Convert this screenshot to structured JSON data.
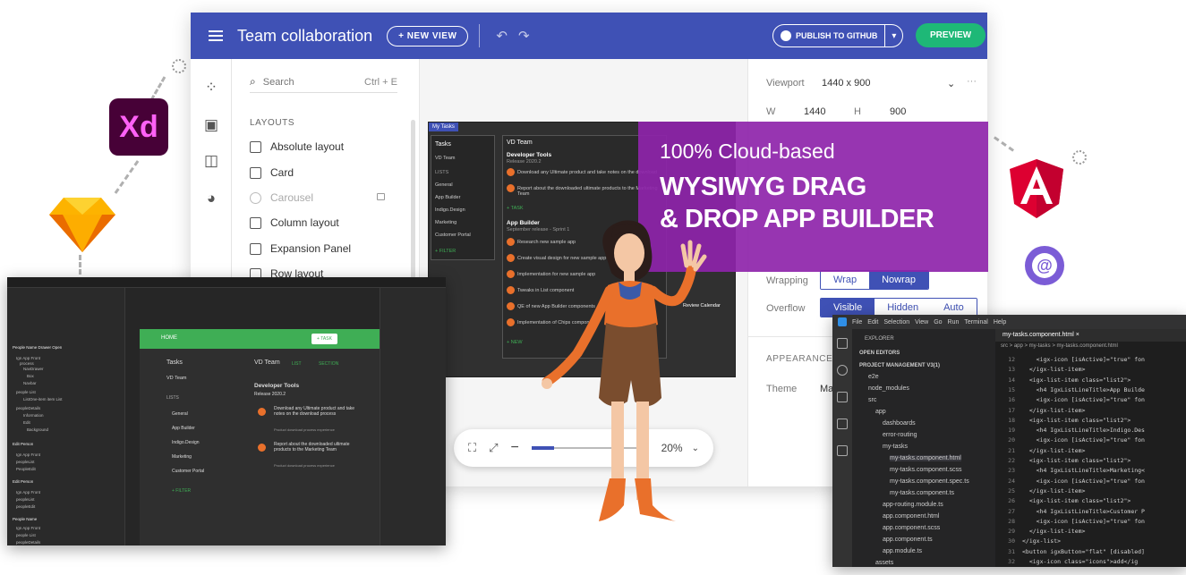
{
  "topbar": {
    "title": "Team collaboration",
    "new_view": "+ NEW VIEW",
    "publish": "PUBLISH TO GITHUB",
    "preview": "PREVIEW"
  },
  "components": {
    "search_placeholder": "Search",
    "search_shortcut": "Ctrl + E",
    "section": "LAYOUTS",
    "items": [
      {
        "label": "Absolute layout"
      },
      {
        "label": "Card"
      },
      {
        "label": "Carousel",
        "disabled": true
      },
      {
        "label": "Column layout"
      },
      {
        "label": "Expansion Panel"
      },
      {
        "label": "Row layout"
      }
    ]
  },
  "properties": {
    "viewport_label": "Viewport",
    "viewport_value": "1440 x 900",
    "w_label": "W",
    "w_value": "1440",
    "h_label": "H",
    "h_value": "900",
    "wrapping_label": "Wrapping",
    "wrap": "Wrap",
    "nowrap": "Nowrap",
    "overflow_label": "Overflow",
    "visible": "Visible",
    "hidden": "Hidden",
    "auto": "Auto",
    "appearance": "APPEARANCE",
    "theme_label": "Theme",
    "theme_value": "Ma"
  },
  "promo": {
    "line1": "100% Cloud-based",
    "line2": "WYSIWYG DRAG",
    "line3": "& DROP APP BUILDER"
  },
  "dark_preview": {
    "tab": "My Tasks",
    "tasks": "Tasks",
    "team": "VD Team",
    "list_header": "LISTS",
    "lists": [
      "General",
      "App Builder",
      "Indigo.Design",
      "Marketing",
      "Customer Portal"
    ],
    "filter": "+ FILTER",
    "section1_title": "Developer Tools",
    "section1_sub": "Release 2020.2",
    "section1_items": [
      "Download any Ultimate product and take notes on the download",
      "Report about the downloaded ultimate products to the Marketing Team"
    ],
    "task_btn": "+ TASK",
    "section2_title": "App Builder",
    "section2_sub": "September release - Sprint 1",
    "section2_items": [
      "Research new sample app",
      "Create visual design for new sample app",
      "Implementation for new sample app",
      "Tweaks in List component",
      "QE of new App Builder components",
      "Implementation of Chips component"
    ],
    "calendar": "Review Calendar",
    "new_btn": "+ NEW"
  },
  "zoom": {
    "value": "20%",
    "level": 0.2
  },
  "left_ide": {
    "tree": [
      "People Name Drawer Open",
      "Ign App Front",
      "process",
      "NavDrawer",
      "Box",
      "Navbar",
      "people List",
      "ListOne-item item List",
      "peopleDetails",
      "Information",
      "Edit",
      "Background",
      "Edit Person",
      "Ign App Front",
      "peopleList",
      "PeopleEdit",
      "Edit Person",
      "Ign App Front",
      "peopleList",
      "peopleEdit",
      "People Name",
      "Ign App Front",
      "people List",
      "peopleDetails"
    ],
    "home": "HOME",
    "task_btn": "+ TASK",
    "tasks": "Tasks",
    "team": "VD Team",
    "lists_header": "LISTS",
    "lists": [
      "General",
      "App Builder",
      "Indigo.Design",
      "Marketing",
      "Customer Portal"
    ],
    "filter": "+ FILTER",
    "main_team": "VD Team",
    "list_tab": "LIST",
    "section_tab": "SECTION",
    "dev_tools": "Developer Tools",
    "release": "Release 2020.2",
    "item1": "Download any Ultimate product and take notes on the download process",
    "item1_sub": "Product download process experience",
    "item2": "Report about the downloaded ultimate products to the Marketing Team",
    "item2_sub": "Product download process experience"
  },
  "vscode": {
    "menu": [
      "File",
      "Edit",
      "Selection",
      "View",
      "Go",
      "Run",
      "Terminal",
      "Help"
    ],
    "explorer": "EXPLORER",
    "open_editors": "OPEN EDITORS",
    "project": "PROJECT MANAGEMENT V3(1)",
    "tree": [
      {
        "label": "e2e",
        "indent": 1
      },
      {
        "label": "node_modules",
        "indent": 1
      },
      {
        "label": "src",
        "indent": 1
      },
      {
        "label": "app",
        "indent": 2
      },
      {
        "label": "dashboards",
        "indent": 3
      },
      {
        "label": "error-routing",
        "indent": 3
      },
      {
        "label": "my-tasks",
        "indent": 3
      },
      {
        "label": "my-tasks.component.html",
        "indent": 4,
        "active": true
      },
      {
        "label": "my-tasks.component.scss",
        "indent": 4
      },
      {
        "label": "my-tasks.component.spec.ts",
        "indent": 4
      },
      {
        "label": "my-tasks.component.ts",
        "indent": 4
      },
      {
        "label": "app-routing.module.ts",
        "indent": 3
      },
      {
        "label": "app.component.html",
        "indent": 3
      },
      {
        "label": "app.component.scss",
        "indent": 3
      },
      {
        "label": "app.component.ts",
        "indent": 3
      },
      {
        "label": "app.module.ts",
        "indent": 3
      },
      {
        "label": "assets",
        "indent": 2
      }
    ],
    "tab": "my-tasks.component.html",
    "breadcrumb": "src > app > my-tasks > my-tasks.component.html",
    "lines": [
      {
        "n": "12",
        "code": "    <igx-icon [isActive]=\"true\" fon"
      },
      {
        "n": "13",
        "code": "  </igx-list-item>"
      },
      {
        "n": "14",
        "code": "  <igx-list-item class=\"list2\">"
      },
      {
        "n": "15",
        "code": "    <h4 IgxListLineTitle>App Builde"
      },
      {
        "n": "16",
        "code": "    <igx-icon [isActive]=\"true\" fon"
      },
      {
        "n": "17",
        "code": "  </igx-list-item>"
      },
      {
        "n": "18",
        "code": "  <igx-list-item class=\"list2\">"
      },
      {
        "n": "19",
        "code": "    <h4 IgxListLineTitle>Indigo.Des"
      },
      {
        "n": "20",
        "code": "    <igx-icon [isActive]=\"true\" fon"
      },
      {
        "n": "21",
        "code": "  </igx-list-item>"
      },
      {
        "n": "22",
        "code": "  <igx-list-item class=\"list2\">"
      },
      {
        "n": "23",
        "code": "    <h4 IgxListLineTitle>Marketing<"
      },
      {
        "n": "24",
        "code": "    <igx-icon [isActive]=\"true\" fon"
      },
      {
        "n": "25",
        "code": "  </igx-list-item>"
      },
      {
        "n": "26",
        "code": "  <igx-list-item class=\"list2\">"
      },
      {
        "n": "27",
        "code": "    <h4 IgxListLineTitle>Customer P"
      },
      {
        "n": "28",
        "code": "    <igx-icon [isActive]=\"true\" fon"
      },
      {
        "n": "29",
        "code": "  </igx-list-item>"
      },
      {
        "n": "30",
        "code": "</igx-list>"
      },
      {
        "n": "31",
        "code": "<button igxButton=\"flat\" [disabled]"
      },
      {
        "n": "32",
        "code": "  <igx-icon class=\"icons\">add</ig"
      }
    ]
  },
  "logos": {
    "xd": "Xd"
  },
  "colors": {
    "primary": "#3f51b5",
    "accent_green": "#1eb877",
    "promo_purple": "#8e24aa",
    "app_green": "#3fae55"
  }
}
